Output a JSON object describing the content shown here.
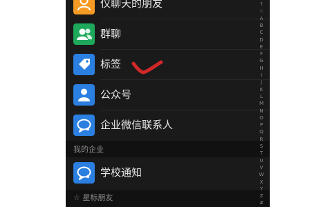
{
  "contacts_list": {
    "rows": [
      {
        "label": "仅聊天的朋友",
        "icon": "person-icon",
        "color": "#f59b23"
      },
      {
        "label": "群聊",
        "icon": "group-icon",
        "color": "#1ea85b"
      },
      {
        "label": "标签",
        "icon": "tag-icon",
        "color": "#2a7fe0"
      },
      {
        "label": "公众号",
        "icon": "official-account-icon",
        "color": "#2a7fe0"
      },
      {
        "label": "企业微信联系人",
        "icon": "chat-bubble-icon",
        "color": "#2a7fe0"
      }
    ],
    "section_enterprise": {
      "label": "我的企业"
    },
    "school_row": {
      "label": "学校通知",
      "icon": "chat-bubble-icon",
      "color": "#2a7fe0"
    },
    "section_starred": {
      "label": "☆ 星标朋友"
    }
  },
  "index_bar": {
    "letters": [
      "↑",
      "☆",
      "A",
      "B",
      "C",
      "D",
      "E",
      "F",
      "G",
      "H",
      "I",
      "J",
      "K",
      "L",
      "M",
      "N",
      "O",
      "P",
      "Q",
      "R",
      "S",
      "T",
      "U",
      "V",
      "W",
      "X",
      "Y",
      "Z",
      "#"
    ]
  },
  "annotation": {
    "color": "#d02828"
  }
}
